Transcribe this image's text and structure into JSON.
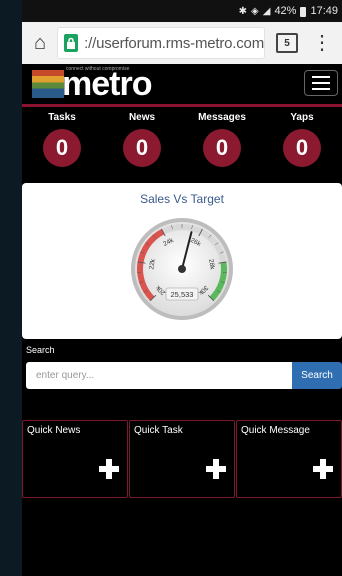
{
  "status_bar": {
    "icons": [
      "bluetooth-icon",
      "wifi-icon",
      "signal-icon"
    ],
    "battery": "42%",
    "time": "17:49"
  },
  "browser": {
    "url": "://userforum.rms-metro.com",
    "tab_count": "5",
    "lock_color": "#1aa260"
  },
  "header": {
    "logo_text": "metro",
    "tagline": "connect without compromise"
  },
  "stats": [
    {
      "label": "Tasks",
      "count": "0"
    },
    {
      "label": "News",
      "count": "0"
    },
    {
      "label": "Messages",
      "count": "0"
    },
    {
      "label": "Yaps",
      "count": "0"
    }
  ],
  "gauge": {
    "title": "Sales Vs Target",
    "value": 25533,
    "value_display": "25,533",
    "min": 20000,
    "max": 30000,
    "ticks": [
      "20k",
      "22k",
      "24k",
      "26k",
      "28k",
      "30k"
    ],
    "bands": [
      {
        "from": 20000,
        "to": 24000,
        "color": "#d9534f"
      },
      {
        "from": 24000,
        "to": 28000,
        "color": "#d8d8d8"
      },
      {
        "from": 28000,
        "to": 30000,
        "color": "#5cb85c"
      }
    ]
  },
  "search": {
    "label": "Search",
    "placeholder": "enter query...",
    "button": "Search"
  },
  "quick": [
    {
      "label": "Quick News"
    },
    {
      "label": "Quick Task"
    },
    {
      "label": "Quick Message"
    }
  ],
  "colors": {
    "accent": "#8b1a30",
    "search_button": "#2f6fb1"
  }
}
